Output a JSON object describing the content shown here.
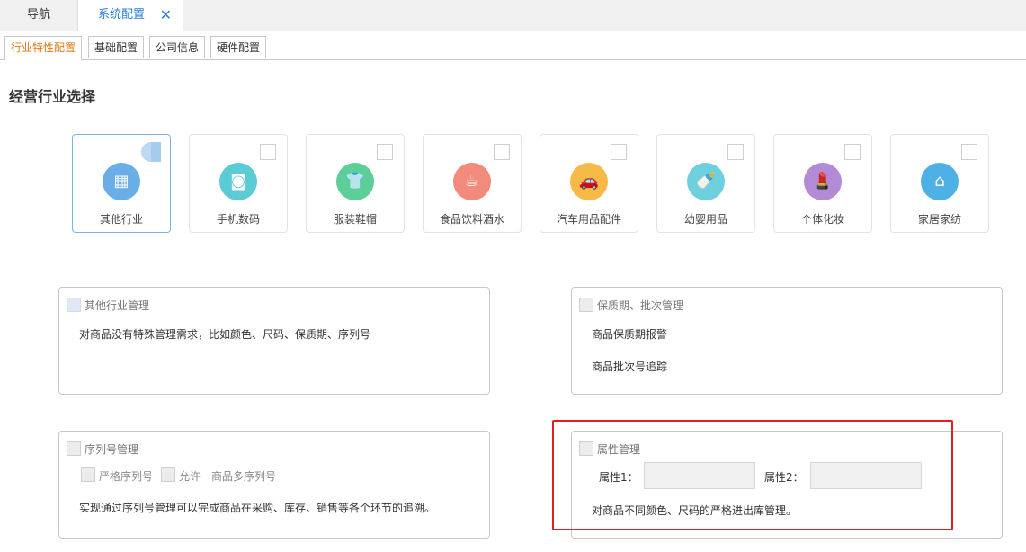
{
  "top_tabs": {
    "nav": "导航",
    "active": "系统配置"
  },
  "sub_tabs": [
    "行业特性配置",
    "基础配置",
    "公司信息",
    "硬件配置"
  ],
  "section_title": "经营行业选择",
  "industries": [
    {
      "name": "其他行业",
      "icon": "apps-icon",
      "color": "#6aaee8",
      "glyph": "▦",
      "selected": true
    },
    {
      "name": "手机数码",
      "icon": "camera-icon",
      "color": "#5bcbd6",
      "glyph": "◙",
      "selected": false
    },
    {
      "name": "服装鞋帽",
      "icon": "shirt-icon",
      "color": "#5ccf99",
      "glyph": "👕",
      "selected": false
    },
    {
      "name": "食品饮料酒水",
      "icon": "mug-icon",
      "color": "#f28b7c",
      "glyph": "☕",
      "selected": false
    },
    {
      "name": "汽车用品配件",
      "icon": "car-icon",
      "color": "#f7b948",
      "glyph": "🚗",
      "selected": false
    },
    {
      "name": "幼婴用品",
      "icon": "bottle-icon",
      "color": "#6ed0dd",
      "glyph": "🍼",
      "selected": false
    },
    {
      "name": "个体化妆",
      "icon": "lipstick-icon",
      "color": "#b38ad6",
      "glyph": "💄",
      "selected": false
    },
    {
      "name": "家居家纺",
      "icon": "home-icon",
      "color": "#4fb0e6",
      "glyph": "⌂",
      "selected": false
    }
  ],
  "panels": {
    "other": {
      "title": "其他行业管理",
      "desc": "对商品没有特殊管理需求，比如颜色、尺码、保质期、序列号"
    },
    "shelf": {
      "title": "保质期、批次管理",
      "line1": "商品保质期报警",
      "line2": "商品批次号追踪"
    },
    "serial": {
      "title": "序列号管理",
      "opt1": "严格序列号",
      "opt2": "允许一商品多序列号",
      "desc": "实现通过序列号管理可以完成商品在采购、库存、销售等各个环节的追溯。"
    },
    "attr": {
      "title": "属性管理",
      "label1": "属性1：",
      "label2": "属性2：",
      "value1": "",
      "value2": "",
      "desc": "对商品不同颜色、尺码的严格进出库管理。"
    }
  },
  "colors": {
    "accent_blue": "#2b7fd4",
    "active_subtab": "#e07a1a",
    "highlight_red": "#e02020"
  }
}
